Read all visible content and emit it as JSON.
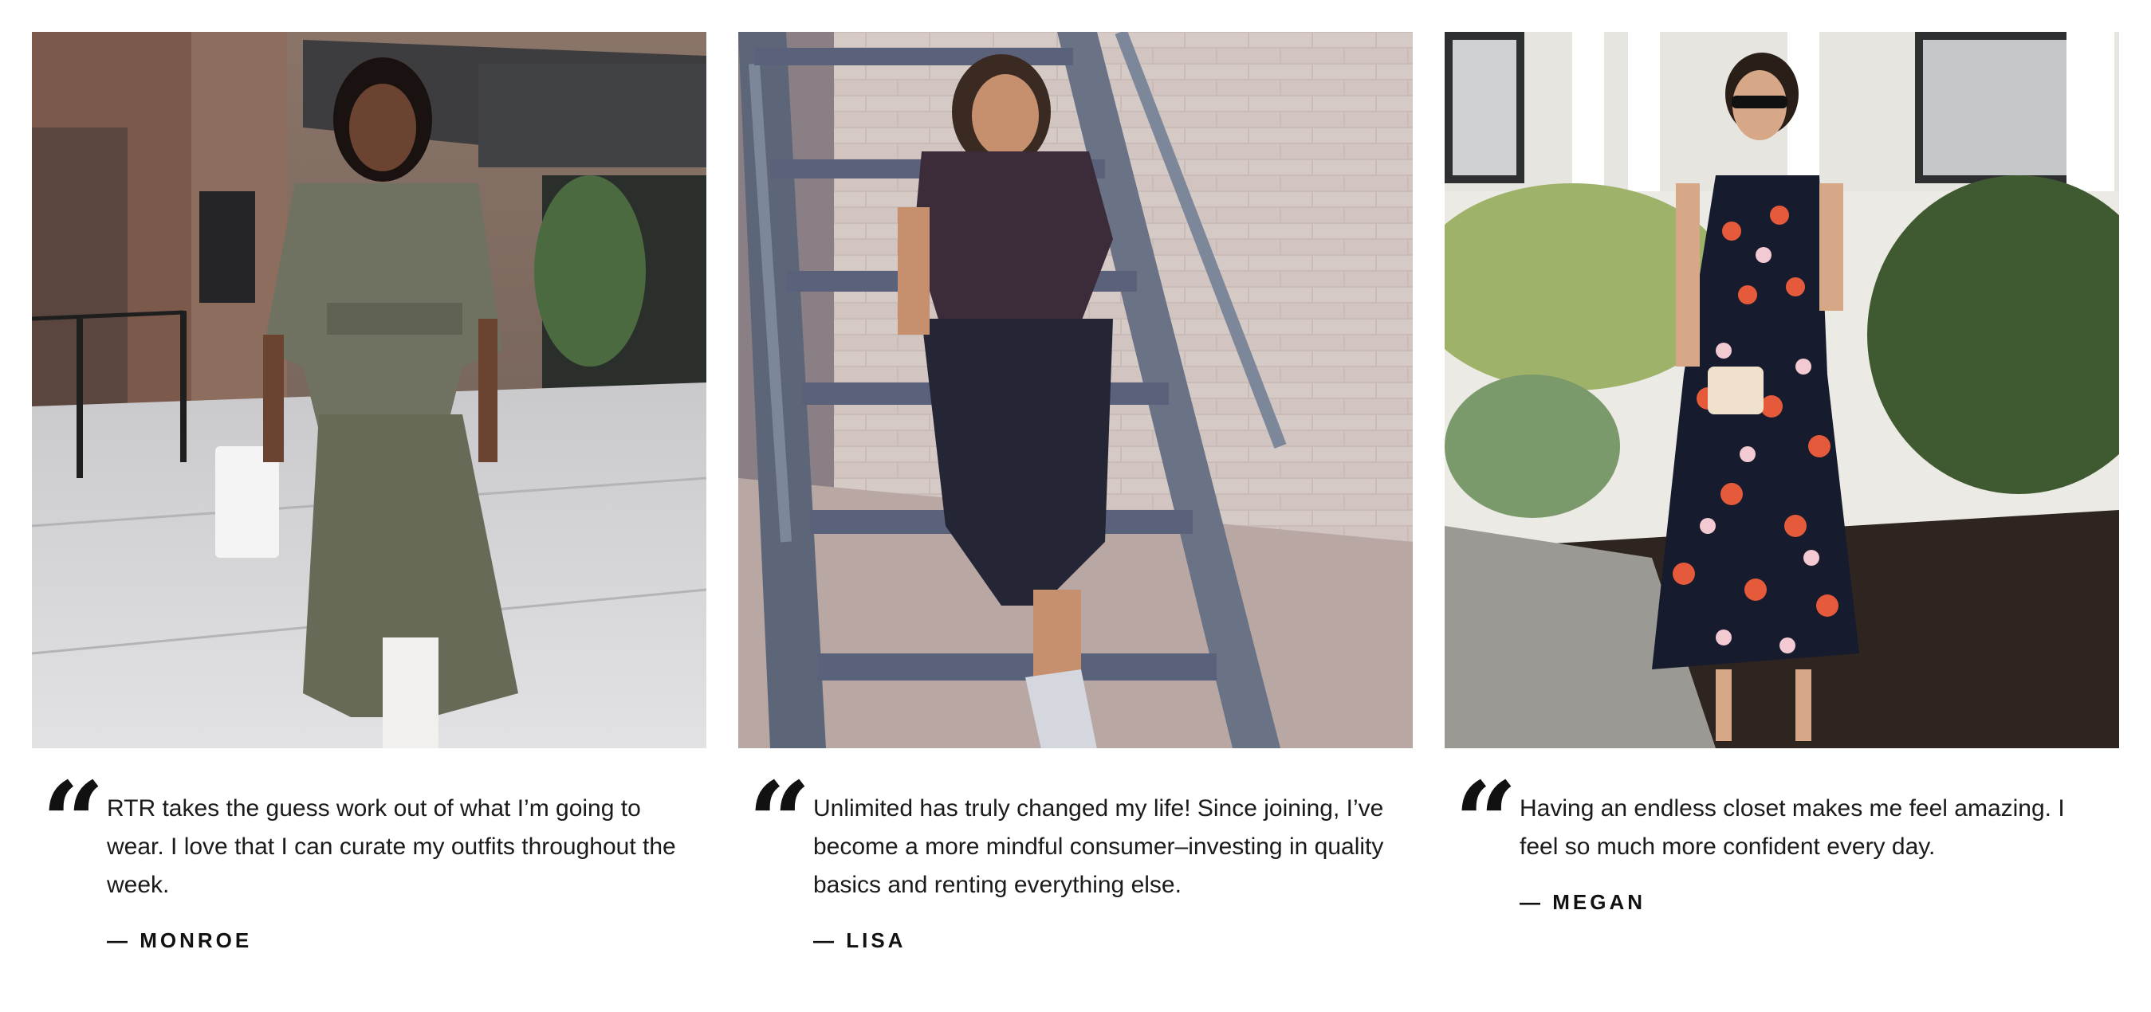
{
  "testimonials": [
    {
      "quote_mark": "“",
      "quote": "RTR takes the guess work out of what I’m going to wear. I love that I can curate my outfits throughout the week.",
      "author": "— MONROE",
      "photo_icon": "street-style-photo"
    },
    {
      "quote_mark": "“",
      "quote": "Unlimited has truly changed my life! Since joining, I’ve become a more mindful consumer–investing in quality basics and renting everything else.",
      "author": "— LISA",
      "photo_icon": "stairs-photo"
    },
    {
      "quote_mark": "“",
      "quote": "Having an endless closet makes me feel amazing. I feel so much more confident every day.",
      "author": "— MEGAN",
      "photo_icon": "garden-photo"
    }
  ],
  "colors": {
    "text": "#1b1b1b",
    "background": "#ffffff"
  }
}
